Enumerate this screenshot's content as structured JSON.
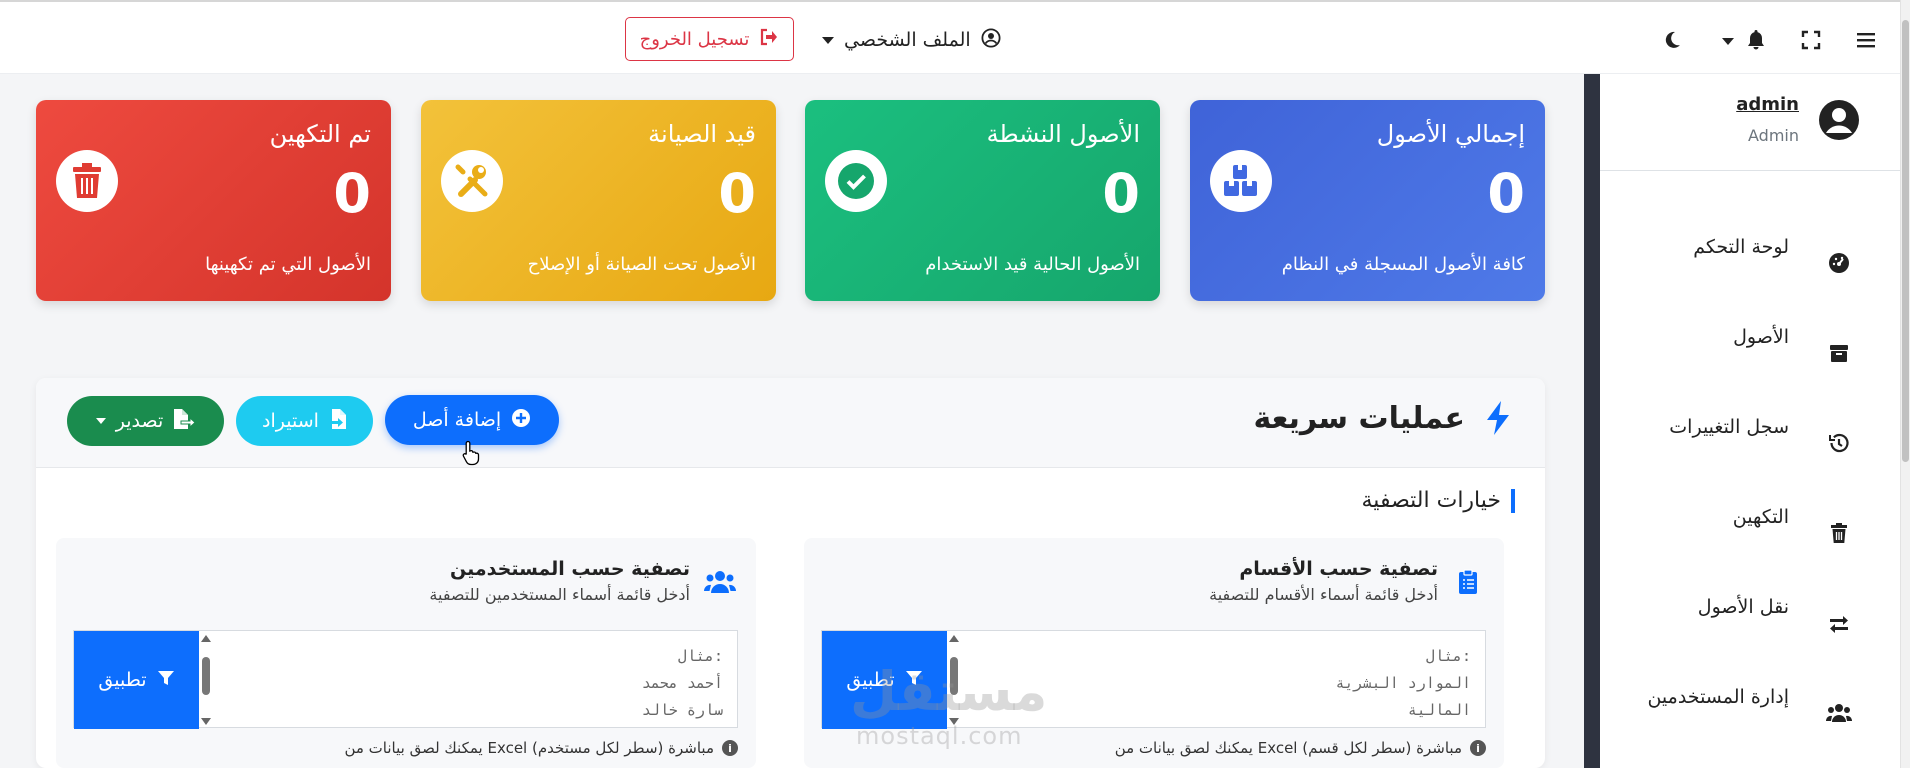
{
  "topbar": {
    "logout_label": "تسجيل الخروج",
    "profile_label": "الملف الشخصي",
    "icons": [
      "moon-icon",
      "bell-icon",
      "expand-icon",
      "menu-icon"
    ]
  },
  "sidebar": {
    "user": {
      "name": "admin",
      "role": "Admin"
    },
    "items": [
      {
        "label": "لوحة التحكم",
        "icon": "dashboard-icon"
      },
      {
        "label": "الأصول",
        "icon": "box-icon"
      },
      {
        "label": "سجل التغييرات",
        "icon": "history-icon"
      },
      {
        "label": "التكهين",
        "icon": "trash-icon"
      },
      {
        "label": "نقل الأصول",
        "icon": "transfer-icon"
      },
      {
        "label": "إدارة المستخدمين",
        "icon": "users-icon"
      }
    ]
  },
  "stats": [
    {
      "title": "إجمالي الأصول",
      "count": "0",
      "desc": "كافة الأصول المسجلة في النظام",
      "color": "#4169e1"
    },
    {
      "title": "الأصول النشطة",
      "count": "0",
      "desc": "الأصول الحالية قيد الاستخدام",
      "color": "#19b377"
    },
    {
      "title": "قيد الصيانة",
      "count": "0",
      "desc": "الأصول تحت الصيانة أو الإصلاح",
      "color": "#efb526"
    },
    {
      "title": "تم التكهين",
      "count": "0",
      "desc": "الأصول التي تم تكهينها",
      "color": "#e03c33"
    }
  ],
  "quick_actions": {
    "title": "عمليات سريعة",
    "add_label": "إضافة أصل",
    "import_label": "استيراد",
    "export_label": "تصدير"
  },
  "filters": {
    "section_label": "خيارات التصفية",
    "departments": {
      "title": "تصفية حسب الأقسام",
      "subtitle": "أدخل قائمة أسماء الأقسام للتصفية",
      "lines": "مثال:\nالموارد البشرية\nالمالية",
      "apply_label": "تطبيق",
      "note": "يمكنك لصق بيانات من Excel مباشرة (سطر لكل قسم)"
    },
    "users": {
      "title": "تصفية حسب المستخدمين",
      "subtitle": "أدخل قائمة أسماء المستخدمين للتصفية",
      "lines": "مثال:\nأحمد محمد\nسارة خالد",
      "apply_label": "تطبيق",
      "note": "يمكنك لصق بيانات من Excel مباشرة (سطر لكل مستخدم)"
    }
  },
  "watermark": {
    "arabic": "مستقل",
    "latin": "mostaql.com"
  }
}
